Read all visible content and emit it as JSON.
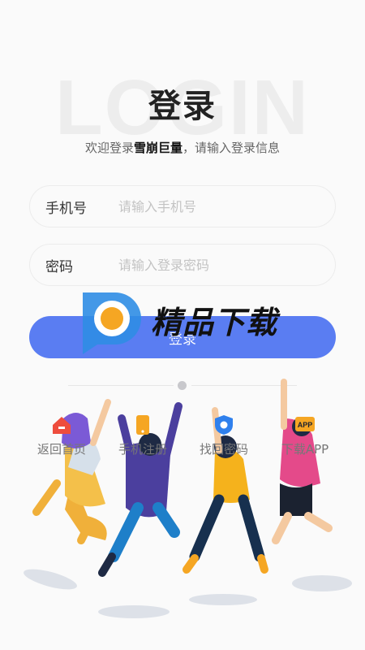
{
  "background_word": "LOGIN",
  "header": {
    "title": "登录",
    "subtitle_prefix": "欢迎登录",
    "subtitle_brand": "雪崩巨量",
    "subtitle_suffix": "，请输入登录信息"
  },
  "form": {
    "phone_label": "手机号",
    "phone_placeholder": "请输入手机号",
    "password_label": "密码",
    "password_placeholder": "请输入登录密码",
    "login_label": "登录"
  },
  "links": [
    {
      "label": "返回首页",
      "icon": "home-icon"
    },
    {
      "label": "手机注册",
      "icon": "phone-icon"
    },
    {
      "label": "找回密码",
      "icon": "shield-icon"
    },
    {
      "label": "下载APP",
      "icon": "app-icon"
    }
  ],
  "watermark": {
    "text": "精品下载",
    "url": "www.jpxz.com"
  },
  "colors": {
    "accent": "#5a7df2",
    "background": "#fafafa"
  }
}
